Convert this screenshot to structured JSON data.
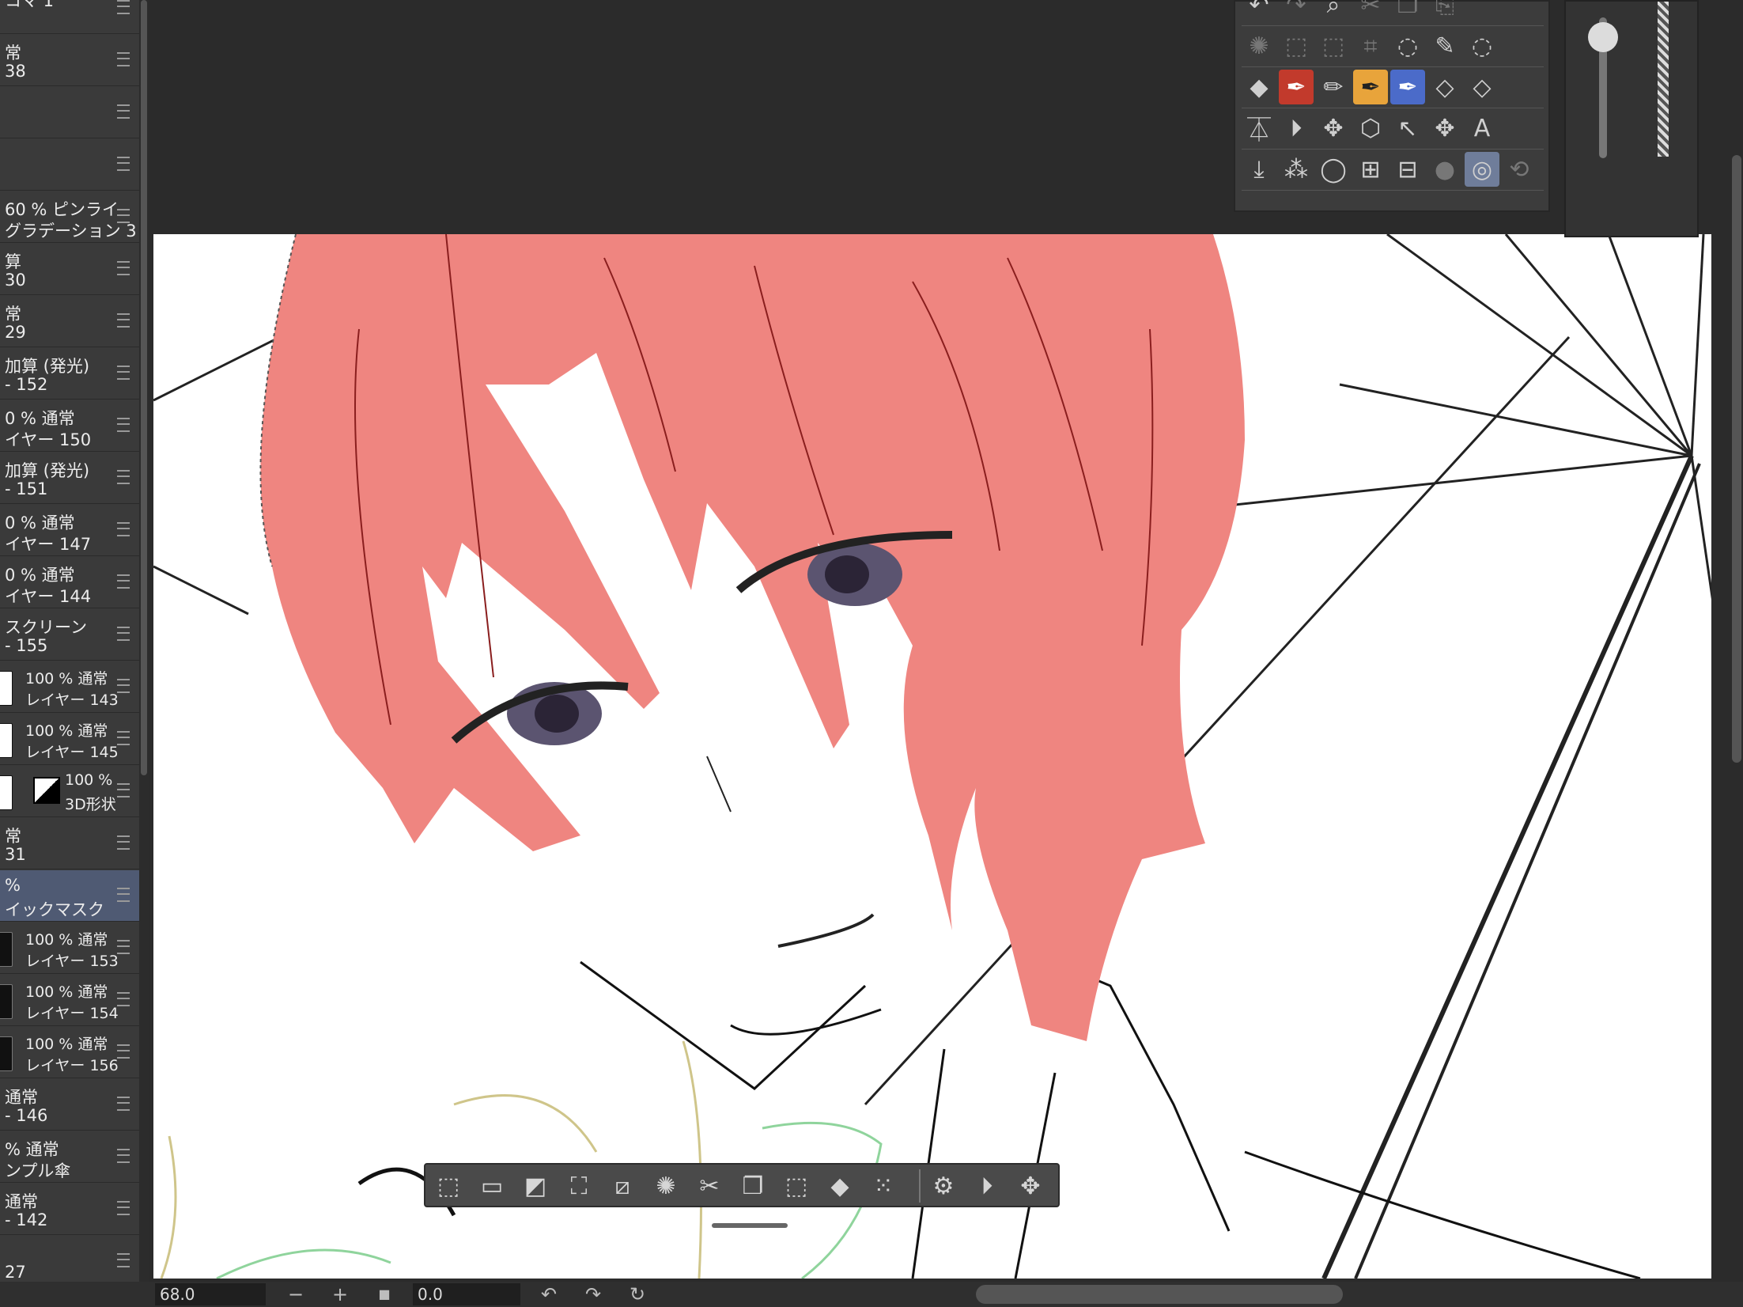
{
  "colors": {
    "hair_fill": "#ef8580",
    "panel_bg": "#3a3a3a",
    "selected_layer": "#4f5a73",
    "canvas_bg": "#ffffff"
  },
  "layers": [
    {
      "line1": "コマ 1",
      "line2": ""
    },
    {
      "line1": "常",
      "line2": "38"
    },
    {
      "line1": "",
      "line2": ""
    },
    {
      "line1": "",
      "line2": ""
    },
    {
      "line1": "60 % ピンライ",
      "line2": "グラデーション 3"
    },
    {
      "line1": "算",
      "line2": "30"
    },
    {
      "line1": "常",
      "line2": "29"
    },
    {
      "line1": "加算 (発光)",
      "line2": "- 152"
    },
    {
      "line1": "0 % 通常",
      "line2": "イヤー 150"
    },
    {
      "line1": "加算 (発光)",
      "line2": "- 151"
    },
    {
      "line1": "0 % 通常",
      "line2": "イヤー 147"
    },
    {
      "line1": "0 % 通常",
      "line2": "イヤー 144"
    },
    {
      "line1": "スクリーン",
      "line2": "- 155"
    },
    {
      "line1": "100 % 通常",
      "line2": "レイヤー 143",
      "thumb": "white"
    },
    {
      "line1": "100 % 通常",
      "line2": "レイヤー 145",
      "thumb": "white"
    },
    {
      "line1": "100 %",
      "line2": "3D形状",
      "thumb": "white",
      "mask": true
    },
    {
      "line1": "常",
      "line2": "31"
    },
    {
      "line1": "%",
      "line2": "イックマスク",
      "selected": true
    },
    {
      "line1": "100 % 通常",
      "line2": "レイヤー 153",
      "thumb": "dark"
    },
    {
      "line1": "100 % 通常",
      "line2": "レイヤー 154",
      "thumb": "dark"
    },
    {
      "line1": "100 % 通常",
      "line2": "レイヤー 156",
      "thumb": "dark"
    },
    {
      "line1": "通常",
      "line2": "- 146"
    },
    {
      "line1": "% 通常",
      "line2": "ンプル傘"
    },
    {
      "line1": "通常",
      "line2": "- 142"
    },
    {
      "line1": "",
      "line2": "27"
    }
  ],
  "tool_rows": [
    [
      {
        "name": "undo-icon",
        "glyph": "↶"
      },
      {
        "name": "redo-icon",
        "glyph": "↷",
        "dim": true
      },
      {
        "name": "page-search-icon",
        "glyph": "⌕"
      },
      {
        "name": "cut-icon",
        "glyph": "✂",
        "dim": true
      },
      {
        "name": "copy-icon",
        "glyph": "❐",
        "dim": true
      },
      {
        "name": "paste-icon",
        "glyph": "⎘",
        "dim": true
      }
    ],
    [
      {
        "name": "loading-icon",
        "glyph": "✺",
        "dim": true
      },
      {
        "name": "transform-icon",
        "glyph": "⬚",
        "dim": true
      },
      {
        "name": "free-transform-icon",
        "glyph": "⬚",
        "dim": true
      },
      {
        "name": "mesh-transform-icon",
        "glyph": "⌗",
        "dim": true
      },
      {
        "name": "lasso-icon",
        "glyph": "◌"
      },
      {
        "name": "pen-select-icon",
        "glyph": "✎"
      },
      {
        "name": "lasso-fill-icon",
        "glyph": "◌"
      }
    ],
    [
      {
        "name": "fill-bucket-icon",
        "glyph": "◆"
      },
      {
        "name": "pen-red-icon",
        "glyph": "✒",
        "color": "red"
      },
      {
        "name": "pencil-icon",
        "glyph": "✏"
      },
      {
        "name": "pen-orange-icon",
        "glyph": "✒",
        "color": "orange"
      },
      {
        "name": "pen-blue-icon",
        "glyph": "✒",
        "color": "blue"
      },
      {
        "name": "eraser-icon",
        "glyph": "◇"
      },
      {
        "name": "eraser-soft-icon",
        "glyph": "◇"
      }
    ],
    [
      {
        "name": "flip-vertical-icon",
        "glyph": "⏄"
      },
      {
        "name": "flip-horizontal-icon",
        "glyph": "⏵"
      },
      {
        "name": "move-layer-icon",
        "glyph": "✥"
      },
      {
        "name": "3d-object-icon",
        "glyph": "⬡"
      },
      {
        "name": "select-object-icon",
        "glyph": "↖"
      },
      {
        "name": "move-icon",
        "glyph": "✥"
      },
      {
        "name": "text-icon",
        "glyph": "A"
      }
    ],
    [
      {
        "name": "import-icon",
        "glyph": "⤓"
      },
      {
        "name": "spray-icon",
        "glyph": "⁂"
      },
      {
        "name": "balloon-icon",
        "glyph": "◯"
      },
      {
        "name": "material-icon",
        "glyph": "⊞"
      },
      {
        "name": "frame-icon",
        "glyph": "⊟"
      },
      {
        "name": "record-icon",
        "glyph": "●",
        "dim": true
      },
      {
        "name": "quick-mask-icon",
        "glyph": "◎",
        "active": true
      },
      {
        "name": "lt-icon",
        "glyph": "⟲",
        "dim": true
      }
    ]
  ],
  "selection_tools": [
    {
      "name": "deselect-icon",
      "glyph": "⬚"
    },
    {
      "name": "select-all-icon",
      "glyph": "▭"
    },
    {
      "name": "invert-selection-icon",
      "glyph": "◩"
    },
    {
      "name": "expand-selection-icon",
      "glyph": "⛶"
    },
    {
      "name": "shrink-selection-icon",
      "glyph": "⧄"
    },
    {
      "name": "loading-icon",
      "glyph": "✺"
    },
    {
      "name": "cut-selection-icon",
      "glyph": "✂"
    },
    {
      "name": "copy-selection-icon",
      "glyph": "❐"
    },
    {
      "name": "crop-icon",
      "glyph": "⬚"
    },
    {
      "name": "fill-selection-icon",
      "glyph": "◆"
    },
    {
      "name": "dots-add-icon",
      "glyph": "⁙"
    },
    {
      "name": "selection-settings-icon",
      "glyph": "⚙"
    },
    {
      "name": "flip-icon",
      "glyph": "⏵"
    },
    {
      "name": "move-icon",
      "glyph": "✥"
    }
  ],
  "status": {
    "zoom": "68.0",
    "rotation": "0.0",
    "zoom_out": "−",
    "zoom_in": "+",
    "fit": "■",
    "rotate_left": "↶",
    "rotate_right": "↷",
    "reset_rotation": "↻"
  },
  "brush_size": {
    "level": 0.95
  }
}
